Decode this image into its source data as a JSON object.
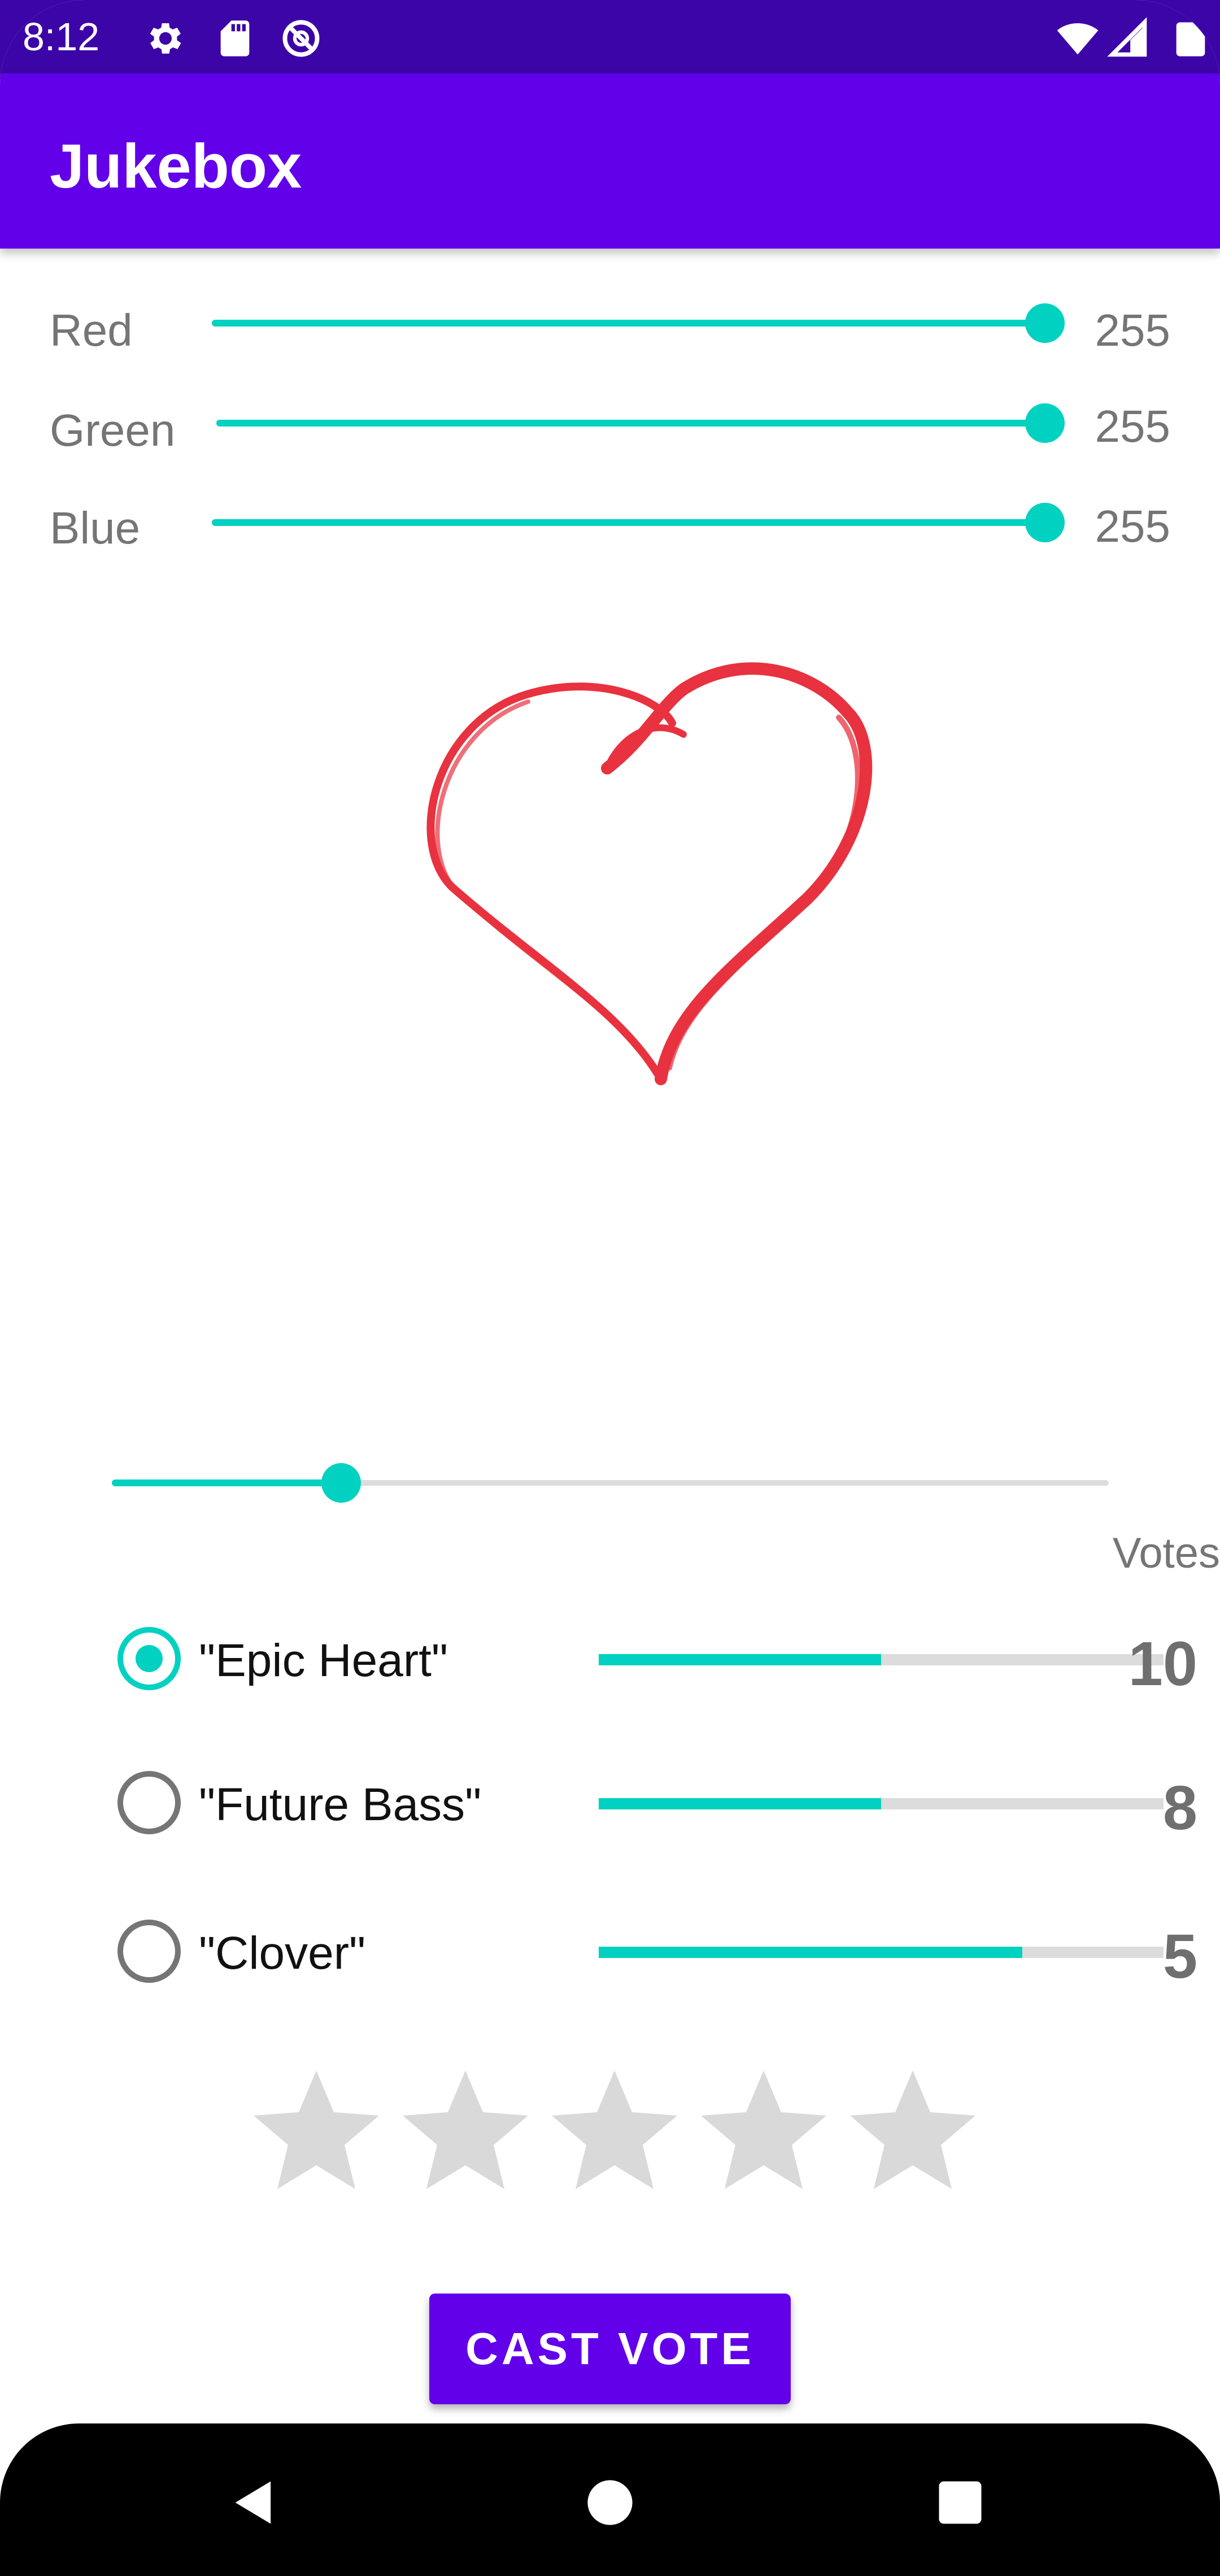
{
  "status_bar": {
    "time": "8:12",
    "icons": [
      "gear-icon",
      "sd-card-icon",
      "do-not-disturb-icon",
      "wifi-icon",
      "signal-icon",
      "battery-icon"
    ]
  },
  "app_bar": {
    "title": "Jukebox"
  },
  "color_sliders": [
    {
      "label": "Red",
      "value": "255",
      "max": 255
    },
    {
      "label": "Green",
      "value": "255",
      "max": 255
    },
    {
      "label": "Blue",
      "value": "255",
      "max": 255
    }
  ],
  "image": {
    "icon": "heart-drawing"
  },
  "size_slider": {
    "fraction": 0.23
  },
  "votes": {
    "header": "Votes",
    "options": [
      {
        "label": "\"Epic Heart\"",
        "count": "10",
        "selected": true,
        "bar_fraction": 0.5
      },
      {
        "label": "\"Future Bass\"",
        "count": "8",
        "selected": false,
        "bar_fraction": 0.5
      },
      {
        "label": "\"Clover\"",
        "count": "5",
        "selected": false,
        "bar_fraction": 0.75
      }
    ]
  },
  "rating": {
    "stars_total": 5,
    "stars_filled": 0
  },
  "cast_vote_button": {
    "label": "CAST VOTE"
  },
  "nav_bar": {
    "icons": [
      "back-icon",
      "home-icon",
      "recents-icon"
    ]
  },
  "colors": {
    "status_bar": "#3c05a8",
    "app_bar": "#6200ea",
    "accent": "#00d1c1",
    "star_empty": "#d9d9d9",
    "heart": "#e8323f"
  }
}
